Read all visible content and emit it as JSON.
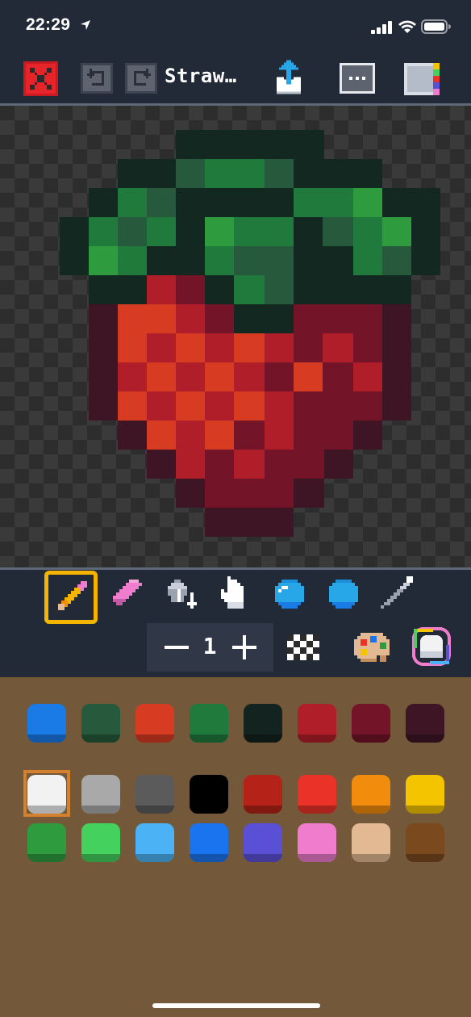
{
  "status_bar": {
    "time": "22:29"
  },
  "toolbar": {
    "title": "Straw…"
  },
  "brush": {
    "size": "1"
  },
  "icons": {
    "close": "close-icon",
    "undo": "undo-icon",
    "redo": "redo-icon",
    "share": "share-icon",
    "more": "more-icon",
    "layers": "layers-icon",
    "pencil": "pencil-icon",
    "eraser": "eraser-icon",
    "fill": "paint-bucket-icon",
    "hand": "hand-icon",
    "primary_color": "primary-color-icon",
    "secondary_color": "secondary-color-icon",
    "picker": "eyedropper-icon",
    "transparency": "checkerboard-icon",
    "palette_editor": "artist-palette-icon",
    "current_color": "current-color-icon"
  },
  "palette": {
    "rows": [
      [
        "#1a7ae6",
        "#275a3c",
        "#d73c22",
        "#1f7a3c",
        "#13231f",
        "#b01e2a",
        "#731429",
        "#3d1525"
      ],
      [
        "#f2f2f2",
        "#a9a9a9",
        "#5b5b5b",
        "#000000",
        "#b52318",
        "#ea3228",
        "#f28c0c",
        "#f5c400"
      ],
      [
        "#2e9b3e",
        "#44d15d",
        "#4bb3f5",
        "#1a74f0",
        "#5a50d6",
        "#ef7ccc",
        "#e2b992",
        "#7a4a1e"
      ]
    ],
    "selected_color": "#f2f2f2"
  },
  "accent_color": "#f5b400"
}
